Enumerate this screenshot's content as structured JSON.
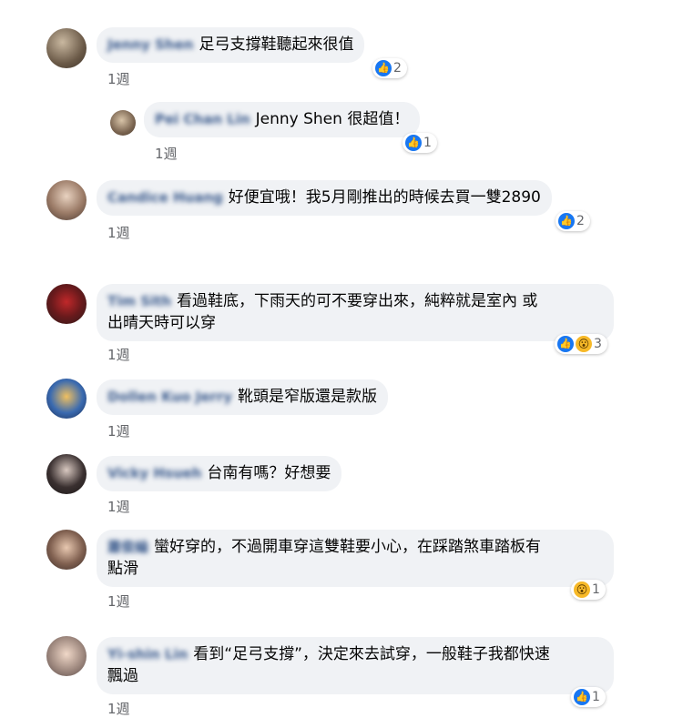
{
  "comments": [
    {
      "author": "Jenny Shen",
      "text": "足弓支撐鞋聽起來很值",
      "time": "1週",
      "reactions": {
        "like": true,
        "wow": false,
        "count": "2"
      }
    },
    {
      "author": "Pei Chan Lin",
      "mention": "Jenny Shen",
      "text": "很超值！",
      "time": "1週",
      "reactions": {
        "like": true,
        "wow": false,
        "count": "1"
      }
    },
    {
      "author": "Candice Huang",
      "text": "好便宜哦！我5月剛推出的時候去買一雙2890",
      "time": "1週",
      "reactions": {
        "like": true,
        "wow": false,
        "count": "2"
      }
    },
    {
      "author": "Tim Sith",
      "text": "看過鞋底，下雨天的可不要穿出來，純粹就是室內 或",
      "text2": "出晴天時可以穿",
      "time": "1週",
      "reactions": {
        "like": true,
        "wow": true,
        "count": "3"
      }
    },
    {
      "author": "Dollen Kuo Jerry",
      "text": "靴頭是窄版還是款版",
      "time": "1週"
    },
    {
      "author": "Vicky Hsueh",
      "text": "台南有嗎？好想要",
      "time": "1週"
    },
    {
      "author": "蕭俊綸",
      "text": "蠻好穿的，不過開車穿這雙鞋要小心，在踩踏煞車踏板有",
      "text2": "點滑",
      "time": "1週",
      "reactions": {
        "like": false,
        "wow": true,
        "count": "1"
      }
    },
    {
      "author": "Yi-shin Lin",
      "text": "看到“足弓支撐”，決定來去試穿，一般鞋子我都快速",
      "text2": "飄過",
      "time": "1週",
      "reactions": {
        "like": true,
        "wow": false,
        "count": "1"
      }
    }
  ],
  "icons": {
    "like": "thumbs-up-icon",
    "wow": "wow-face-icon"
  },
  "colors": {
    "like": "#1877f2",
    "wow": "#f7b928",
    "bubble": "#f0f2f5",
    "name": "#3a5a8c",
    "meta": "#65676b"
  }
}
